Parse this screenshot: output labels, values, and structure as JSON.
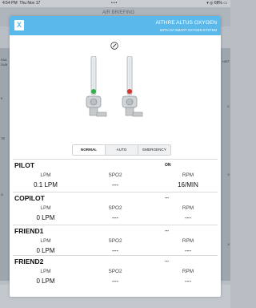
{
  "status_bar": {
    "time": "4:54 PM",
    "date": "Thu Nov 17",
    "battery": "68%",
    "dots": "•••"
  },
  "background": {
    "title": "AIR BRIEFING",
    "left_texts": [
      "FAA",
      "SUB",
      "K",
      "TE",
      "G"
    ],
    "right_texts": [
      "HIST",
      "C",
      "X",
      "X"
    ]
  },
  "modal": {
    "close_label": "X",
    "title": "AITHRE ALTUS OXYGEN",
    "subtitle": "WITH AVI SMART OXYGEN SYSTEM",
    "mode_tabs": [
      {
        "label": "NORMAL",
        "active": true
      },
      {
        "label": "AUTO",
        "active": false
      },
      {
        "label": "EMERGENCY",
        "active": false
      }
    ],
    "flowmeters": [
      {
        "indicator_color": "#2fb14a"
      },
      {
        "indicator_color": "#d6322e"
      }
    ],
    "sections": [
      {
        "name": "PILOT",
        "status": "ON",
        "labels": [
          "LPM",
          "SPO2",
          "RPM"
        ],
        "values": [
          "0.1 LPM",
          "---",
          "16/MIN"
        ]
      },
      {
        "name": "COPILOT",
        "status": "---",
        "labels": [
          "LPM",
          "SPO2",
          "RPM"
        ],
        "values": [
          "0 LPM",
          "---",
          "---"
        ]
      },
      {
        "name": "FRIEND1",
        "status": "---",
        "labels": [
          "LPM",
          "SPO2",
          "RPM"
        ],
        "values": [
          "0 LPM",
          "---",
          "---"
        ]
      },
      {
        "name": "FRIEND2",
        "status": "---",
        "labels": [
          "LPM",
          "SPO2",
          "RPM"
        ],
        "values": [
          "0 LPM",
          "---",
          "---"
        ]
      }
    ]
  },
  "colors": {
    "header": "#5ab8ea",
    "accent_green": "#2fb14a",
    "accent_red": "#d6322e"
  }
}
